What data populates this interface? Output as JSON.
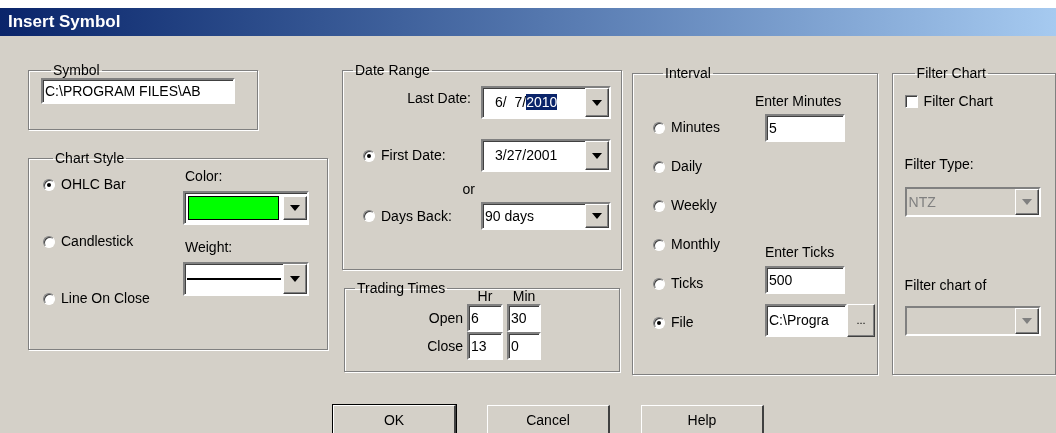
{
  "window": {
    "title": "Insert Symbol"
  },
  "symbol": {
    "label": "Symbol",
    "value": "C:\\PROGRAM FILES\\AB"
  },
  "chart_style": {
    "label": "Chart Style",
    "options": [
      {
        "label": "OHLC Bar",
        "selected": true
      },
      {
        "label": "Candlestick",
        "selected": false
      },
      {
        "label": "Line On Close",
        "selected": false
      }
    ],
    "color_label": "Color:",
    "color": "#00ff00",
    "weight_label": "Weight:"
  },
  "date_range": {
    "label": "Date Range",
    "last_date": {
      "label": "Last Date:",
      "value": "6/  7/",
      "highlighted": "2010"
    },
    "modes": [
      {
        "label": "First Date:",
        "value": "3/27/2001",
        "selected": true
      },
      {
        "label": "Days Back:",
        "value": "90 days",
        "selected": false
      }
    ],
    "or_label": "or"
  },
  "trading_times": {
    "label": "Trading Times",
    "columns": [
      "Hr",
      "Min"
    ],
    "rows": [
      {
        "label": "Open",
        "hr": "6",
        "min": "30"
      },
      {
        "label": "Close",
        "hr": "13",
        "min": "0"
      }
    ]
  },
  "interval": {
    "label": "Interval",
    "options": [
      {
        "label": "Minutes",
        "selected": false
      },
      {
        "label": "Daily",
        "selected": false
      },
      {
        "label": "Weekly",
        "selected": false
      },
      {
        "label": "Monthly",
        "selected": false
      },
      {
        "label": "Ticks",
        "selected": false
      },
      {
        "label": "File",
        "selected": true
      }
    ],
    "minutes": {
      "label": "Enter Minutes",
      "value": "5"
    },
    "ticks": {
      "label": "Enter Ticks",
      "value": "500"
    },
    "file": {
      "value": "C:\\Progra",
      "browse": "..."
    }
  },
  "filter": {
    "label": "Filter Chart",
    "checkbox": {
      "label": "Filter Chart",
      "checked": false
    },
    "type": {
      "label": "Filter Type:",
      "value": "NTZ",
      "disabled": true
    },
    "of": {
      "label": "Filter chart of",
      "disabled": true
    }
  },
  "buttons": [
    {
      "label": "OK",
      "default": true
    },
    {
      "label": "Cancel",
      "default": false
    },
    {
      "label": "Help",
      "default": false
    }
  ]
}
